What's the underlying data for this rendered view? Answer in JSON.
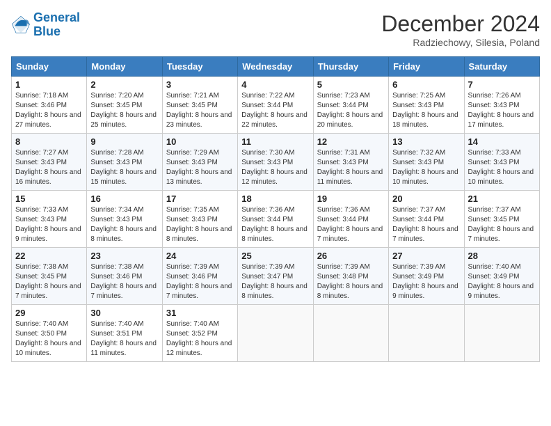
{
  "header": {
    "logo_general": "General",
    "logo_blue": "Blue",
    "month_title": "December 2024",
    "subtitle": "Radziechowy, Silesia, Poland"
  },
  "days_of_week": [
    "Sunday",
    "Monday",
    "Tuesday",
    "Wednesday",
    "Thursday",
    "Friday",
    "Saturday"
  ],
  "weeks": [
    [
      {
        "day": "1",
        "sunrise": "7:18 AM",
        "sunset": "3:46 PM",
        "daylight": "8 hours and 27 minutes."
      },
      {
        "day": "2",
        "sunrise": "7:20 AM",
        "sunset": "3:45 PM",
        "daylight": "8 hours and 25 minutes."
      },
      {
        "day": "3",
        "sunrise": "7:21 AM",
        "sunset": "3:45 PM",
        "daylight": "8 hours and 23 minutes."
      },
      {
        "day": "4",
        "sunrise": "7:22 AM",
        "sunset": "3:44 PM",
        "daylight": "8 hours and 22 minutes."
      },
      {
        "day": "5",
        "sunrise": "7:23 AM",
        "sunset": "3:44 PM",
        "daylight": "8 hours and 20 minutes."
      },
      {
        "day": "6",
        "sunrise": "7:25 AM",
        "sunset": "3:43 PM",
        "daylight": "8 hours and 18 minutes."
      },
      {
        "day": "7",
        "sunrise": "7:26 AM",
        "sunset": "3:43 PM",
        "daylight": "8 hours and 17 minutes."
      }
    ],
    [
      {
        "day": "8",
        "sunrise": "7:27 AM",
        "sunset": "3:43 PM",
        "daylight": "8 hours and 16 minutes."
      },
      {
        "day": "9",
        "sunrise": "7:28 AM",
        "sunset": "3:43 PM",
        "daylight": "8 hours and 15 minutes."
      },
      {
        "day": "10",
        "sunrise": "7:29 AM",
        "sunset": "3:43 PM",
        "daylight": "8 hours and 13 minutes."
      },
      {
        "day": "11",
        "sunrise": "7:30 AM",
        "sunset": "3:43 PM",
        "daylight": "8 hours and 12 minutes."
      },
      {
        "day": "12",
        "sunrise": "7:31 AM",
        "sunset": "3:43 PM",
        "daylight": "8 hours and 11 minutes."
      },
      {
        "day": "13",
        "sunrise": "7:32 AM",
        "sunset": "3:43 PM",
        "daylight": "8 hours and 10 minutes."
      },
      {
        "day": "14",
        "sunrise": "7:33 AM",
        "sunset": "3:43 PM",
        "daylight": "8 hours and 10 minutes."
      }
    ],
    [
      {
        "day": "15",
        "sunrise": "7:33 AM",
        "sunset": "3:43 PM",
        "daylight": "8 hours and 9 minutes."
      },
      {
        "day": "16",
        "sunrise": "7:34 AM",
        "sunset": "3:43 PM",
        "daylight": "8 hours and 8 minutes."
      },
      {
        "day": "17",
        "sunrise": "7:35 AM",
        "sunset": "3:43 PM",
        "daylight": "8 hours and 8 minutes."
      },
      {
        "day": "18",
        "sunrise": "7:36 AM",
        "sunset": "3:44 PM",
        "daylight": "8 hours and 8 minutes."
      },
      {
        "day": "19",
        "sunrise": "7:36 AM",
        "sunset": "3:44 PM",
        "daylight": "8 hours and 7 minutes."
      },
      {
        "day": "20",
        "sunrise": "7:37 AM",
        "sunset": "3:44 PM",
        "daylight": "8 hours and 7 minutes."
      },
      {
        "day": "21",
        "sunrise": "7:37 AM",
        "sunset": "3:45 PM",
        "daylight": "8 hours and 7 minutes."
      }
    ],
    [
      {
        "day": "22",
        "sunrise": "7:38 AM",
        "sunset": "3:45 PM",
        "daylight": "8 hours and 7 minutes."
      },
      {
        "day": "23",
        "sunrise": "7:38 AM",
        "sunset": "3:46 PM",
        "daylight": "8 hours and 7 minutes."
      },
      {
        "day": "24",
        "sunrise": "7:39 AM",
        "sunset": "3:46 PM",
        "daylight": "8 hours and 7 minutes."
      },
      {
        "day": "25",
        "sunrise": "7:39 AM",
        "sunset": "3:47 PM",
        "daylight": "8 hours and 8 minutes."
      },
      {
        "day": "26",
        "sunrise": "7:39 AM",
        "sunset": "3:48 PM",
        "daylight": "8 hours and 8 minutes."
      },
      {
        "day": "27",
        "sunrise": "7:39 AM",
        "sunset": "3:49 PM",
        "daylight": "8 hours and 9 minutes."
      },
      {
        "day": "28",
        "sunrise": "7:40 AM",
        "sunset": "3:49 PM",
        "daylight": "8 hours and 9 minutes."
      }
    ],
    [
      {
        "day": "29",
        "sunrise": "7:40 AM",
        "sunset": "3:50 PM",
        "daylight": "8 hours and 10 minutes."
      },
      {
        "day": "30",
        "sunrise": "7:40 AM",
        "sunset": "3:51 PM",
        "daylight": "8 hours and 11 minutes."
      },
      {
        "day": "31",
        "sunrise": "7:40 AM",
        "sunset": "3:52 PM",
        "daylight": "8 hours and 12 minutes."
      },
      null,
      null,
      null,
      null
    ]
  ],
  "labels": {
    "sunrise": "Sunrise:",
    "sunset": "Sunset:",
    "daylight": "Daylight:"
  }
}
